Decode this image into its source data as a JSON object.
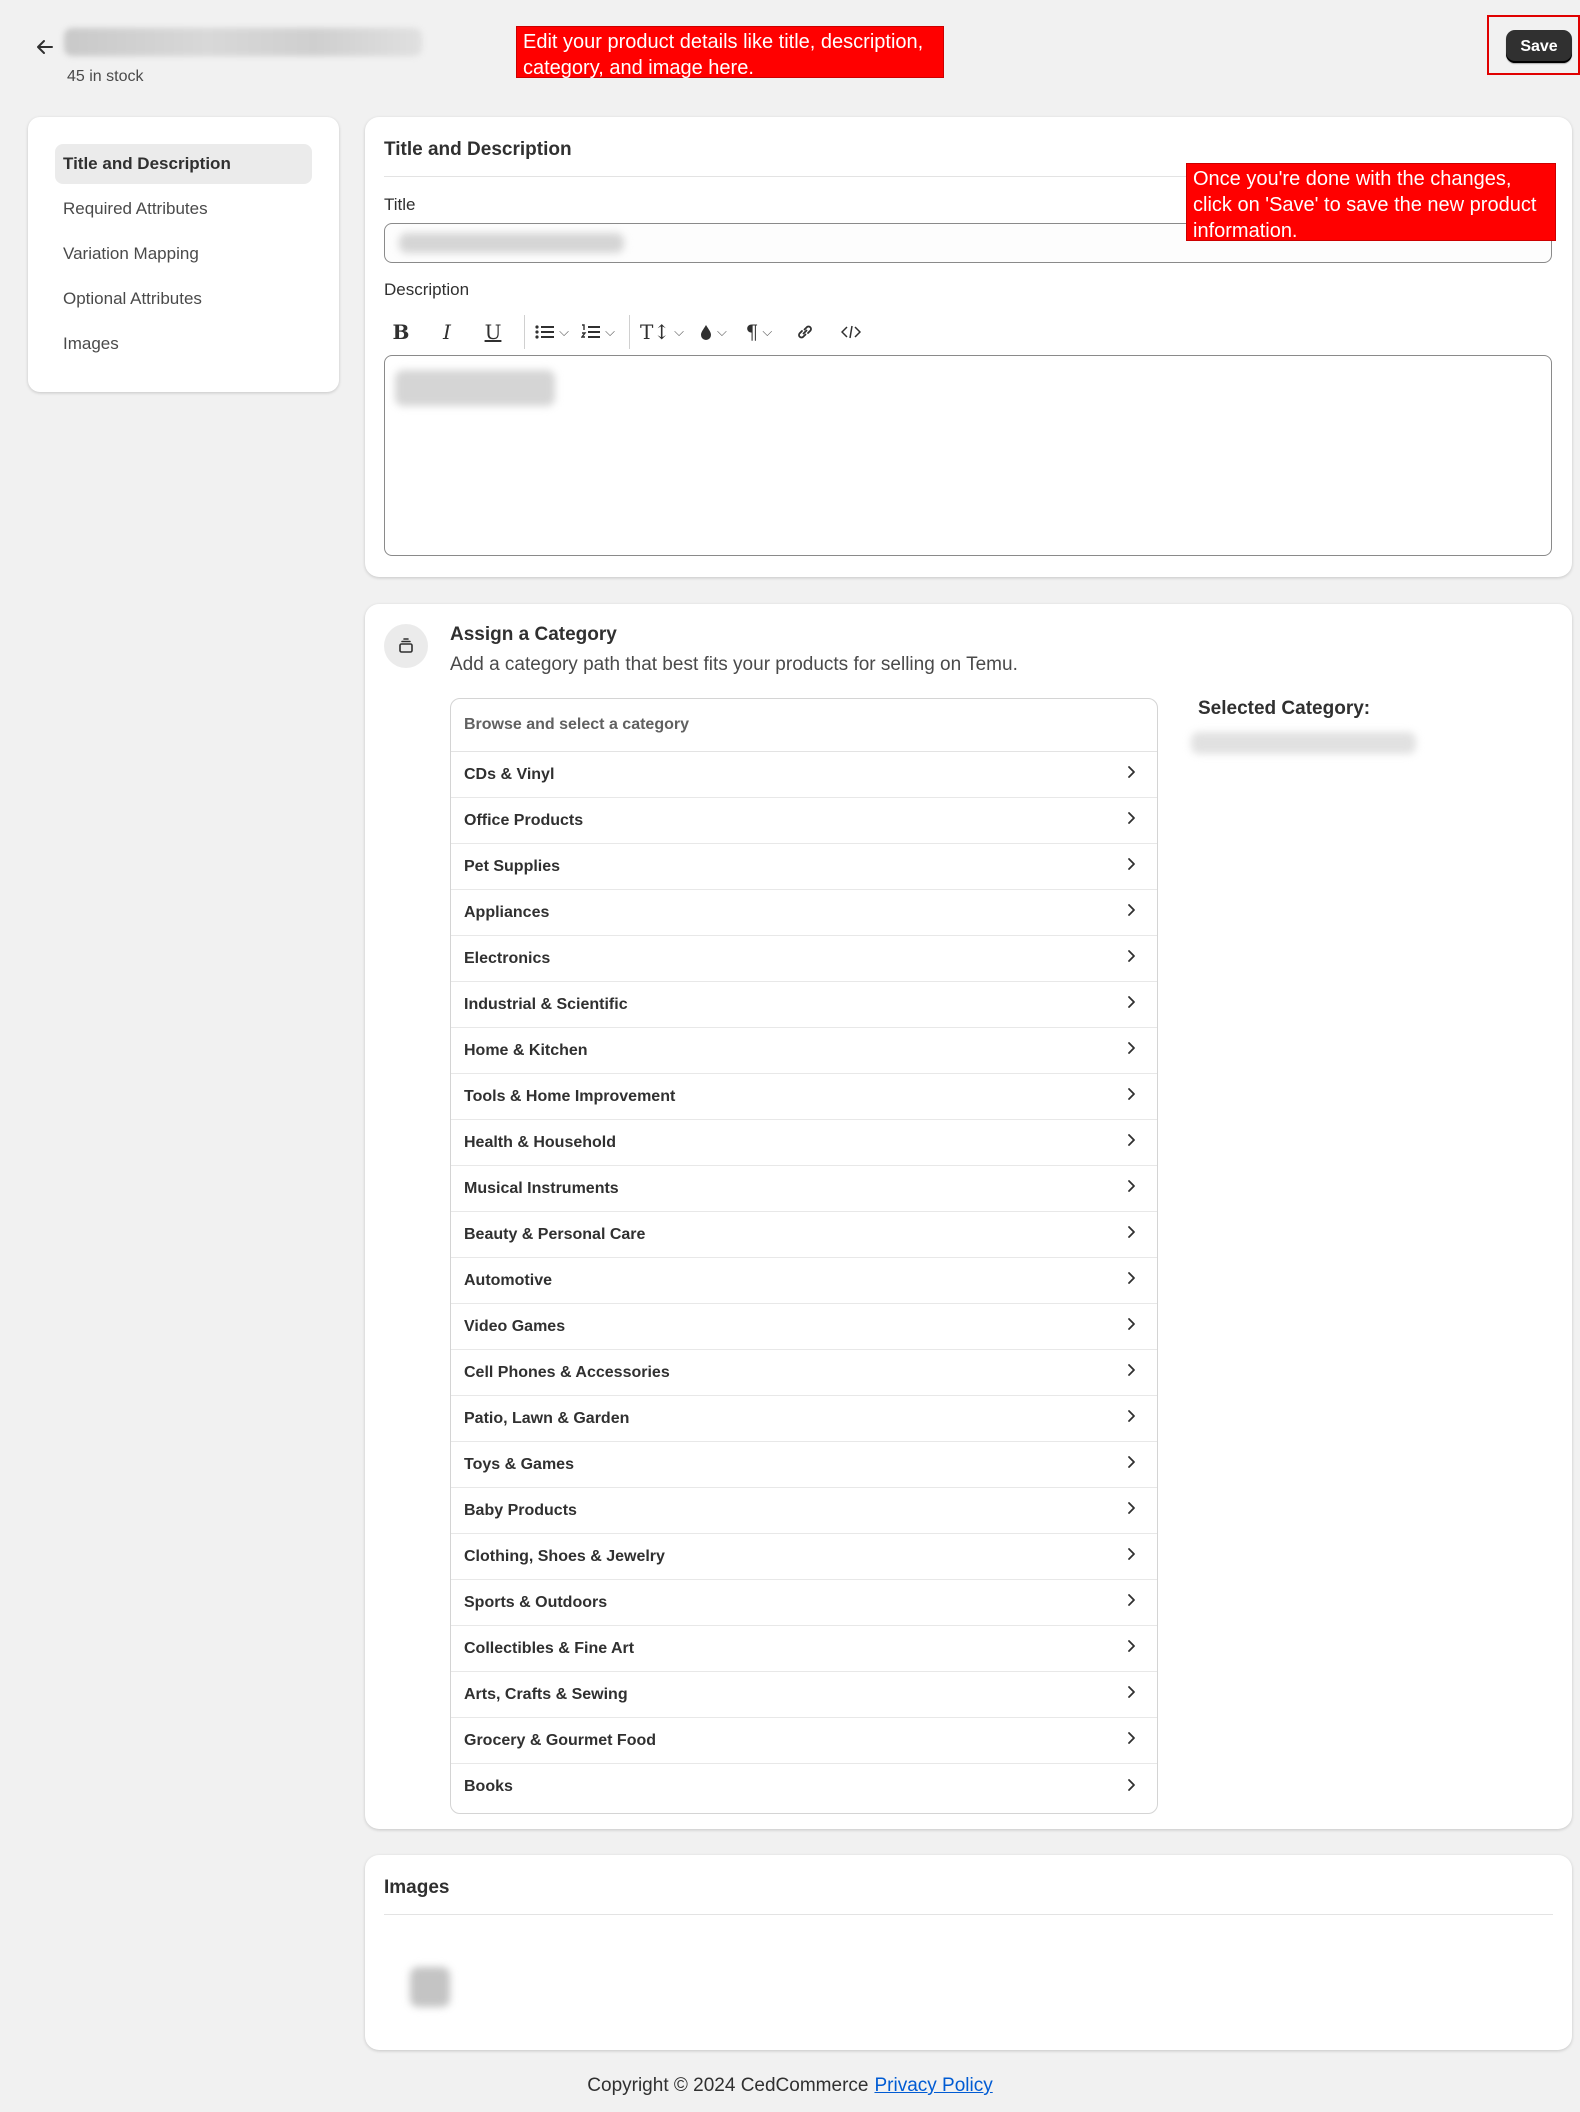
{
  "header": {
    "stock_text": "45 in stock",
    "save_label": "Save"
  },
  "tooltips": {
    "edit_hint": "Edit your product details like title, description, category, and image here.",
    "save_hint": "Once you're done with the changes, click on 'Save' to save the new product information."
  },
  "sidebar": {
    "items": [
      {
        "label": "Title and Description",
        "active": true
      },
      {
        "label": "Required Attributes"
      },
      {
        "label": "Variation Mapping"
      },
      {
        "label": "Optional Attributes"
      },
      {
        "label": "Images"
      }
    ]
  },
  "title_description": {
    "heading": "Title and Description",
    "title_label": "Title",
    "description_label": "Description",
    "toolbar": [
      "bold-icon",
      "italic-icon",
      "underline-icon",
      "bullet-list-icon",
      "numbered-list-icon",
      "text-size-icon",
      "text-color-icon",
      "paragraph-icon",
      "link-icon",
      "code-icon"
    ]
  },
  "category": {
    "title": "Assign a Category",
    "subtitle": "Add a category path that best fits your products for selling on Temu.",
    "browse_label": "Browse and select a category",
    "selected_label": "Selected Category:",
    "items": [
      "CDs & Vinyl",
      "Office Products",
      "Pet Supplies",
      "Appliances",
      "Electronics",
      "Industrial & Scientific",
      "Home & Kitchen",
      "Tools & Home Improvement",
      "Health & Household",
      "Musical Instruments",
      "Beauty & Personal Care",
      "Automotive",
      "Video Games",
      "Cell Phones & Accessories",
      "Patio, Lawn & Garden",
      "Toys & Games",
      "Baby Products",
      "Clothing, Shoes & Jewelry",
      "Sports & Outdoors",
      "Collectibles & Fine Art",
      "Arts, Crafts & Sewing",
      "Grocery & Gourmet Food",
      "Books"
    ]
  },
  "images": {
    "heading": "Images"
  },
  "footer": {
    "copyright": "Copyright © 2024 CedCommerce",
    "privacy_link": "Privacy Policy"
  },
  "colors": {
    "background": "#f1f1f1",
    "card": "#ffffff",
    "tooltip": "#ff0000",
    "primary_button": "#303030",
    "link": "#005bd3"
  }
}
